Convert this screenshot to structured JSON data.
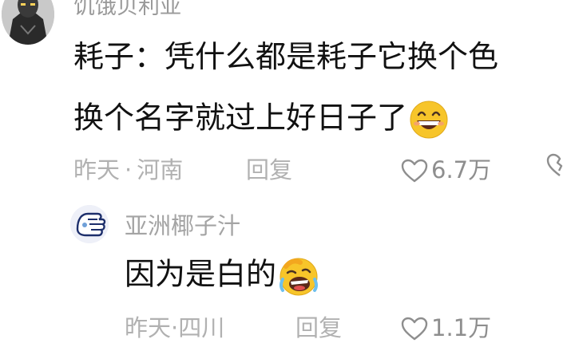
{
  "comment": {
    "username": "饥饿贝利亚",
    "text_line1": "耗子：凭什么都是耗子它换个色",
    "text_line2": "换个名字就过上好日子了",
    "time": "昨天",
    "location": "河南",
    "separator": "·",
    "reply_label": "回复",
    "likes": "6.7万"
  },
  "reply": {
    "username": "亚洲椰子汁",
    "text": "因为是白的",
    "time": "昨天",
    "location": "四川",
    "separator": "·",
    "reply_label": "回复",
    "likes": "1.1万"
  },
  "icons": {
    "heart": "heart-outline-icon",
    "dislike": "broken-heart-icon",
    "emoji_grin": "grinning-face-emoji",
    "emoji_laugh": "laughing-face-emoji"
  },
  "colors": {
    "meta_gray": "#b1b1b1",
    "username_gray": "#9a9a9a",
    "emoji_yellow": "#f7c52a"
  }
}
